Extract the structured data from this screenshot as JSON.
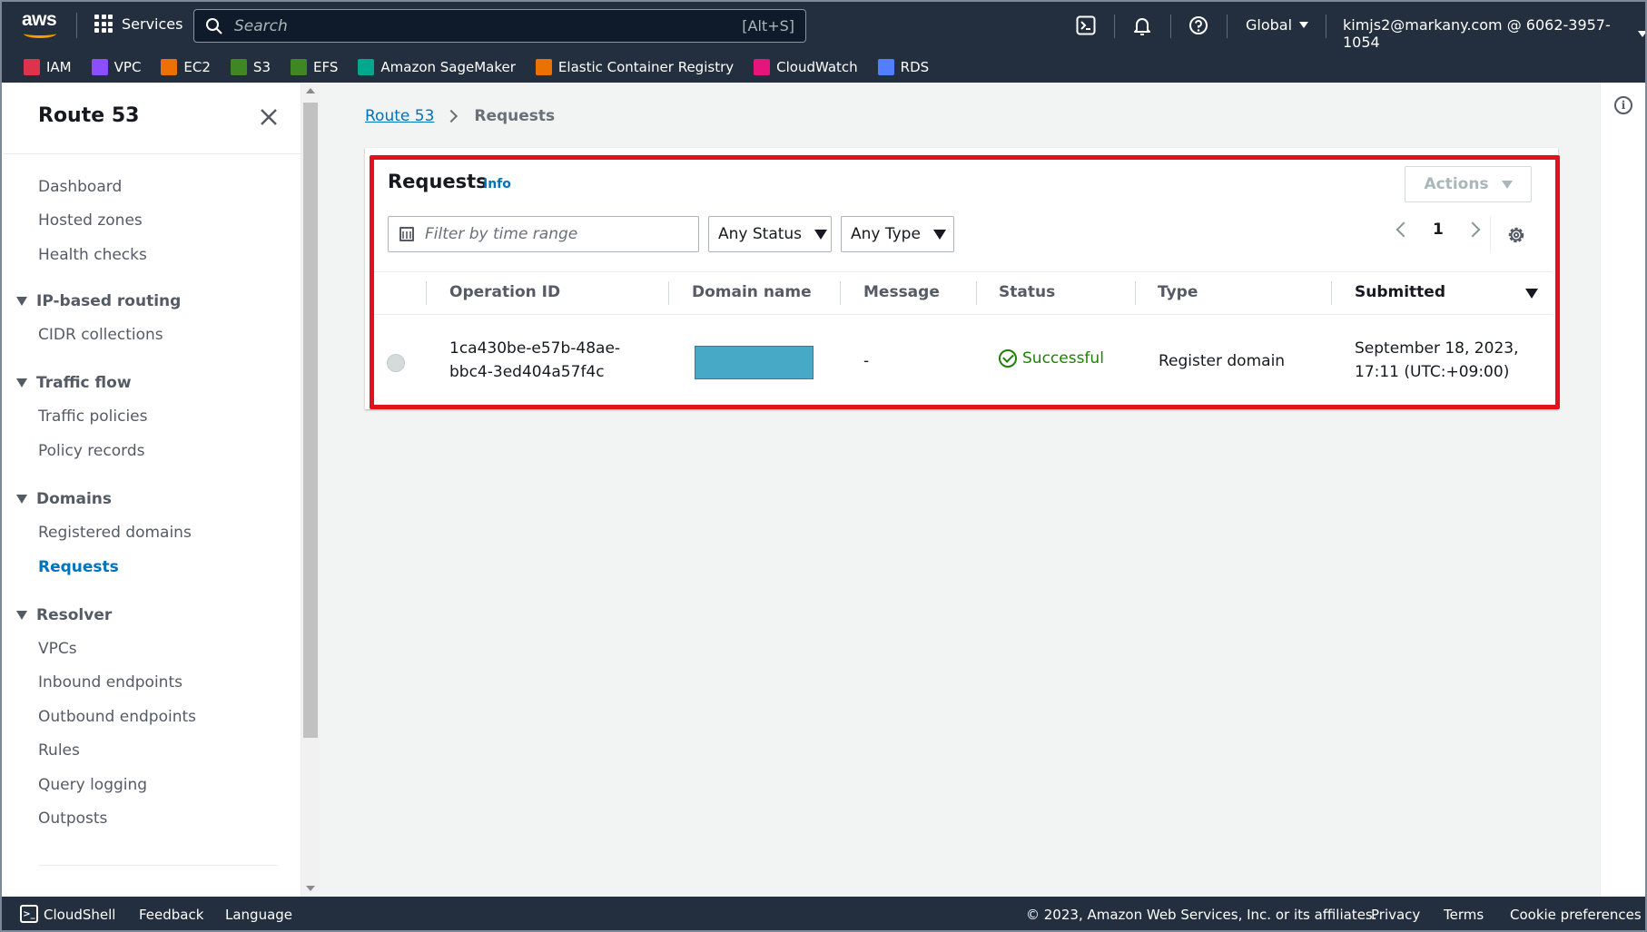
{
  "topnav": {
    "logo_text": "aws",
    "services_label": "Services",
    "search_placeholder": "Search",
    "search_shortcut": "[Alt+S]",
    "region": "Global",
    "account": "kimjs2@markany.com @ 6062-3957-1054"
  },
  "favorites": [
    {
      "label": "IAM",
      "color": "#dd344c",
      "icon": "iam-icon"
    },
    {
      "label": "VPC",
      "color": "#8c4fff",
      "icon": "vpc-icon"
    },
    {
      "label": "EC2",
      "color": "#ed7100",
      "icon": "ec2-icon"
    },
    {
      "label": "S3",
      "color": "#3f8624",
      "icon": "s3-icon"
    },
    {
      "label": "EFS",
      "color": "#3f8624",
      "icon": "efs-icon"
    },
    {
      "label": "Amazon SageMaker",
      "color": "#01a88d",
      "icon": "sagemaker-icon"
    },
    {
      "label": "Elastic Container Registry",
      "color": "#ed7100",
      "icon": "ecr-icon"
    },
    {
      "label": "CloudWatch",
      "color": "#e7157b",
      "icon": "cloudwatch-icon"
    },
    {
      "label": "RDS",
      "color": "#527fff",
      "icon": "rds-icon"
    }
  ],
  "sidenav": {
    "title": "Route 53",
    "items_top": [
      "Dashboard",
      "Hosted zones",
      "Health checks"
    ],
    "groups": [
      {
        "label": "IP-based routing",
        "items": [
          "CIDR collections"
        ]
      },
      {
        "label": "Traffic flow",
        "items": [
          "Traffic policies",
          "Policy records"
        ]
      },
      {
        "label": "Domains",
        "items": [
          "Registered domains",
          "Requests"
        ]
      },
      {
        "label": "Resolver",
        "items": [
          "VPCs",
          "Inbound endpoints",
          "Outbound endpoints",
          "Rules",
          "Query logging",
          "Outposts"
        ]
      }
    ],
    "active_item": "Requests"
  },
  "breadcrumb": {
    "root": "Route 53",
    "current": "Requests"
  },
  "panel": {
    "title": "Requests",
    "info_label": "Info",
    "actions_label": "Actions",
    "filter_placeholder": "Filter by time range",
    "status_filter": "Any Status",
    "type_filter": "Any Type",
    "page_number": "1",
    "columns": [
      "Operation ID",
      "Domain name",
      "Message",
      "Status",
      "Type",
      "Submitted"
    ],
    "rows": [
      {
        "operation_id_line1": "1ca430be-e57b-48ae-",
        "operation_id_line2": "bbc4-3ed404a57f4c",
        "domain_name": "",
        "message": "-",
        "status": "Successful",
        "type": "Register domain",
        "submitted_line1": "September 18, 2023,",
        "submitted_line2": "17:11 (UTC:+09:00)"
      }
    ]
  },
  "footer": {
    "cloudshell": "CloudShell",
    "feedback": "Feedback",
    "language": "Language",
    "copyright": "© 2023, Amazon Web Services, Inc. or its affiliates.",
    "privacy": "Privacy",
    "terms": "Terms",
    "cookies": "Cookie preferences"
  },
  "colors": {
    "nav_bg": "#232f3e",
    "link": "#0073bb",
    "success": "#1d8102",
    "highlight": "#e0131d",
    "redacted": "#47a9c6"
  }
}
